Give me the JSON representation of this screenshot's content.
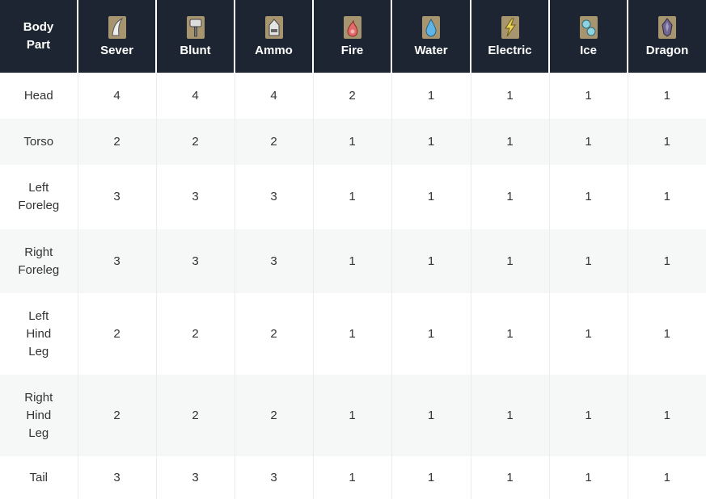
{
  "header": {
    "body_part": "Body\nPart",
    "columns": [
      {
        "label": "Sever",
        "icon": "sever-icon"
      },
      {
        "label": "Blunt",
        "icon": "blunt-icon"
      },
      {
        "label": "Ammo",
        "icon": "ammo-icon"
      },
      {
        "label": "Fire",
        "icon": "fire-icon"
      },
      {
        "label": "Water",
        "icon": "water-icon"
      },
      {
        "label": "Electric",
        "icon": "electric-icon"
      },
      {
        "label": "Ice",
        "icon": "ice-icon"
      },
      {
        "label": "Dragon",
        "icon": "dragon-icon"
      }
    ]
  },
  "rows": [
    {
      "part": "Head",
      "values": [
        "4",
        "4",
        "4",
        "2",
        "1",
        "1",
        "1",
        "1"
      ]
    },
    {
      "part": "Torso",
      "values": [
        "2",
        "2",
        "2",
        "1",
        "1",
        "1",
        "1",
        "1"
      ]
    },
    {
      "part": "Left\nForeleg",
      "values": [
        "3",
        "3",
        "3",
        "1",
        "1",
        "1",
        "1",
        "1"
      ]
    },
    {
      "part": "Right\nForeleg",
      "values": [
        "3",
        "3",
        "3",
        "1",
        "1",
        "1",
        "1",
        "1"
      ]
    },
    {
      "part": "Left\nHind\nLeg",
      "values": [
        "2",
        "2",
        "2",
        "1",
        "1",
        "1",
        "1",
        "1"
      ]
    },
    {
      "part": "Right\nHind\nLeg",
      "values": [
        "2",
        "2",
        "2",
        "1",
        "1",
        "1",
        "1",
        "1"
      ]
    },
    {
      "part": "Tail",
      "values": [
        "3",
        "3",
        "3",
        "1",
        "1",
        "1",
        "1",
        "1"
      ]
    }
  ]
}
